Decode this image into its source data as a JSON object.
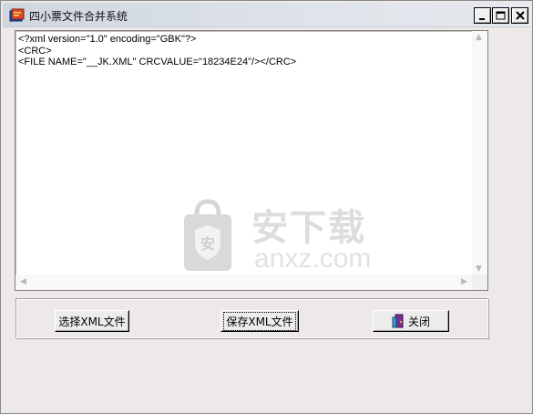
{
  "window": {
    "title": "四小票文件合并系统",
    "controls": {
      "minimize": "_",
      "maximize": "□",
      "close": "×"
    }
  },
  "editor": {
    "lines": [
      "<?xml version=\"1.0\" encoding=\"GBK\"?>",
      "<CRC>",
      "<FILE NAME=\"__JK.XML\" CRCVALUE=\"18234E24\"/></CRC>"
    ]
  },
  "watermark": {
    "cn": "安下载",
    "en": "anxz.com",
    "shield_char": "安"
  },
  "buttons": {
    "select_xml": "选择XML文件",
    "save_xml": "保存XML文件",
    "close": "关闭"
  },
  "icons": {
    "app": "app-book-icon",
    "close_button": "door-exit-icon"
  },
  "colors": {
    "window_bg": "#ece9e8",
    "titlebar": "#dfe4ea",
    "watermark": "#dddddd"
  }
}
